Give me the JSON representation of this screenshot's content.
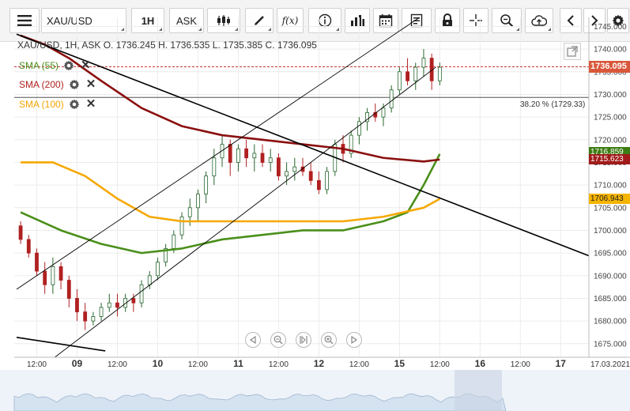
{
  "toolbar": {
    "symbol": "XAU/USD",
    "timeframe": "1H",
    "price_type": "ASK",
    "fx_label": "f(x)"
  },
  "legend": {
    "text": "XAU/USD, 1H, ASK   O. 1736.245 H. 1736.535 L. 1735.385 C. 1736.095"
  },
  "indicators": [
    {
      "label": "SMA (55)",
      "color": "#4a8f1a"
    },
    {
      "label": "SMA (200)",
      "color": "#b02020"
    },
    {
      "label": "SMA (100)",
      "color": "#f2a500"
    }
  ],
  "fib_label": "38.20 % (1729.33)",
  "price_labels": {
    "current": "1736.095",
    "sma55": "1716.859",
    "sma200": "1715.623",
    "sma100": "1706.943"
  },
  "colors": {
    "bull": "#27662d",
    "bear": "#b02020",
    "sma55": "#4a8f1a",
    "sma200": "#8b0f0f",
    "sma100": "#f5a800",
    "current_price_bg": "#d9573a",
    "sma200_bg": "#a11b1b",
    "sma55_bg": "#3d7d13",
    "sma100_bg": "#f5b400"
  },
  "chart_data": {
    "type": "candlestick",
    "title": "XAU/USD, 1H, ASK",
    "y_ticks": [
      1675,
      1680,
      1685,
      1690,
      1695,
      1700,
      1705,
      1710,
      1715,
      1720,
      1725,
      1730,
      1735,
      1740,
      1745
    ],
    "y_tick_labels": [
      "1675.000",
      "1680.000",
      "1685.000",
      "1690.000",
      "1695.000",
      "1700.000",
      "1705.000",
      "1710.000",
      "1715.000",
      "1720.000",
      "1725.000",
      "1730.000",
      "1735.000",
      "1740.000",
      "1745.000"
    ],
    "ylim": [
      1672,
      1747
    ],
    "x_range": [
      0,
      71
    ],
    "x_ticks": [
      {
        "i": 2.5,
        "label": "12:00",
        "bold": false
      },
      {
        "i": 7.5,
        "label": "09",
        "bold": true
      },
      {
        "i": 12.5,
        "label": "12:00",
        "bold": false
      },
      {
        "i": 17.5,
        "label": "10",
        "bold": true
      },
      {
        "i": 22.5,
        "label": "12:00",
        "bold": false
      },
      {
        "i": 27.5,
        "label": "11",
        "bold": true
      },
      {
        "i": 32.5,
        "label": "12:00",
        "bold": false
      },
      {
        "i": 37.5,
        "label": "12",
        "bold": true
      },
      {
        "i": 42.5,
        "label": "12:00",
        "bold": false
      },
      {
        "i": 47.5,
        "label": "15",
        "bold": true
      },
      {
        "i": 52.5,
        "label": "12:00",
        "bold": false
      },
      {
        "i": 57.5,
        "label": "16",
        "bold": true
      },
      {
        "i": 62.5,
        "label": "12:00",
        "bold": false
      },
      {
        "i": 67.5,
        "label": "17",
        "bold": true
      },
      {
        "i": 71,
        "label": "17.03.2021",
        "bold": false
      }
    ],
    "candles": [
      [
        1701,
        1702,
        1697,
        1698
      ],
      [
        1698,
        1699,
        1694,
        1695
      ],
      [
        1695,
        1696,
        1690,
        1691
      ],
      [
        1691,
        1693,
        1686,
        1688
      ],
      [
        1688,
        1694,
        1686,
        1692
      ],
      [
        1692,
        1693,
        1687,
        1689
      ],
      [
        1689,
        1690,
        1683,
        1685
      ],
      [
        1685,
        1687,
        1680,
        1682
      ],
      [
        1682,
        1684,
        1678,
        1680
      ],
      [
        1680,
        1682,
        1679,
        1681
      ],
      [
        1681,
        1684,
        1680,
        1683
      ],
      [
        1683,
        1686,
        1682,
        1684
      ],
      [
        1684,
        1686,
        1681,
        1683
      ],
      [
        1683,
        1686,
        1682,
        1685
      ],
      [
        1685,
        1686,
        1682,
        1684
      ],
      [
        1684,
        1689,
        1683,
        1688
      ],
      [
        1688,
        1691,
        1687,
        1690
      ],
      [
        1690,
        1694,
        1689,
        1693
      ],
      [
        1693,
        1697,
        1692,
        1696
      ],
      [
        1696,
        1700,
        1695,
        1699
      ],
      [
        1699,
        1704,
        1698,
        1703
      ],
      [
        1703,
        1707,
        1701,
        1705
      ],
      [
        1705,
        1709,
        1702,
        1708
      ],
      [
        1708,
        1713,
        1706,
        1712
      ],
      [
        1712,
        1718,
        1710,
        1716
      ],
      [
        1716,
        1721,
        1714,
        1719
      ],
      [
        1719,
        1720,
        1712,
        1715
      ],
      [
        1715,
        1719,
        1713,
        1718
      ],
      [
        1718,
        1720,
        1714,
        1716
      ],
      [
        1716,
        1719,
        1713,
        1717
      ],
      [
        1717,
        1719,
        1714,
        1715
      ],
      [
        1715,
        1718,
        1713,
        1716
      ],
      [
        1716,
        1717,
        1711,
        1712
      ],
      [
        1712,
        1715,
        1710,
        1713
      ],
      [
        1713,
        1716,
        1711,
        1714
      ],
      [
        1714,
        1716,
        1712,
        1713
      ],
      [
        1713,
        1715,
        1710,
        1711
      ],
      [
        1711,
        1713,
        1708,
        1709
      ],
      [
        1709,
        1714,
        1708,
        1713
      ],
      [
        1713,
        1720,
        1712,
        1719
      ],
      [
        1719,
        1721,
        1715,
        1717
      ],
      [
        1717,
        1722,
        1716,
        1721
      ],
      [
        1721,
        1725,
        1719,
        1724
      ],
      [
        1724,
        1727,
        1722,
        1726
      ],
      [
        1726,
        1728,
        1724,
        1725
      ],
      [
        1725,
        1728,
        1723,
        1727
      ],
      [
        1727,
        1732,
        1726,
        1731
      ],
      [
        1731,
        1736,
        1730,
        1735
      ],
      [
        1735,
        1738,
        1732,
        1733
      ],
      [
        1733,
        1737,
        1731,
        1736
      ],
      [
        1736,
        1740,
        1734,
        1738
      ],
      [
        1738,
        1739,
        1731,
        1733
      ],
      [
        1733,
        1737,
        1732,
        1736
      ]
    ],
    "series": [
      {
        "name": "SMA (55)",
        "points": [
          [
            0,
            1704
          ],
          [
            5,
            1700
          ],
          [
            10,
            1697
          ],
          [
            15,
            1695
          ],
          [
            20,
            1696
          ],
          [
            25,
            1698
          ],
          [
            30,
            1699
          ],
          [
            35,
            1700
          ],
          [
            40,
            1700
          ],
          [
            45,
            1702
          ],
          [
            48,
            1704
          ],
          [
            50,
            1710
          ],
          [
            52,
            1716.859
          ]
        ]
      },
      {
        "name": "SMA (200)",
        "points": [
          [
            0,
            1743
          ],
          [
            3,
            1741
          ],
          [
            6,
            1738
          ],
          [
            10,
            1733
          ],
          [
            15,
            1727
          ],
          [
            20,
            1723
          ],
          [
            25,
            1721
          ],
          [
            30,
            1720
          ],
          [
            35,
            1719
          ],
          [
            40,
            1718
          ],
          [
            45,
            1716
          ],
          [
            50,
            1715.2
          ],
          [
            52,
            1715.623
          ]
        ]
      },
      {
        "name": "SMA (100)",
        "points": [
          [
            0,
            1715
          ],
          [
            4,
            1715
          ],
          [
            8,
            1712
          ],
          [
            12,
            1707
          ],
          [
            16,
            1703
          ],
          [
            20,
            1702
          ],
          [
            25,
            1702
          ],
          [
            30,
            1702
          ],
          [
            35,
            1702
          ],
          [
            40,
            1702
          ],
          [
            45,
            1703
          ],
          [
            50,
            1705
          ],
          [
            52,
            1706.943
          ]
        ]
      }
    ],
    "trend_lines": [
      {
        "from": [
          0,
          1743.3
        ],
        "to": [
          71,
          1694.4
        ],
        "color": "#000000",
        "width": 1.6
      },
      {
        "from": [
          0,
          1676.4
        ],
        "to": [
          11,
          1673.4
        ],
        "color": "#000000",
        "width": 1.6
      },
      {
        "from": [
          0,
          1687
        ],
        "to": [
          50,
          1747
        ],
        "color": "#000000",
        "width": 0.9
      },
      {
        "from": [
          4,
          1671
        ],
        "to": [
          52,
          1736
        ],
        "color": "#000000",
        "width": 0.9
      }
    ],
    "horizontal_lines": [
      {
        "y": 1729.33,
        "color": "#555555",
        "dash": false
      },
      {
        "y": 1736.095,
        "color": "#cc3333",
        "dash": true
      }
    ]
  }
}
